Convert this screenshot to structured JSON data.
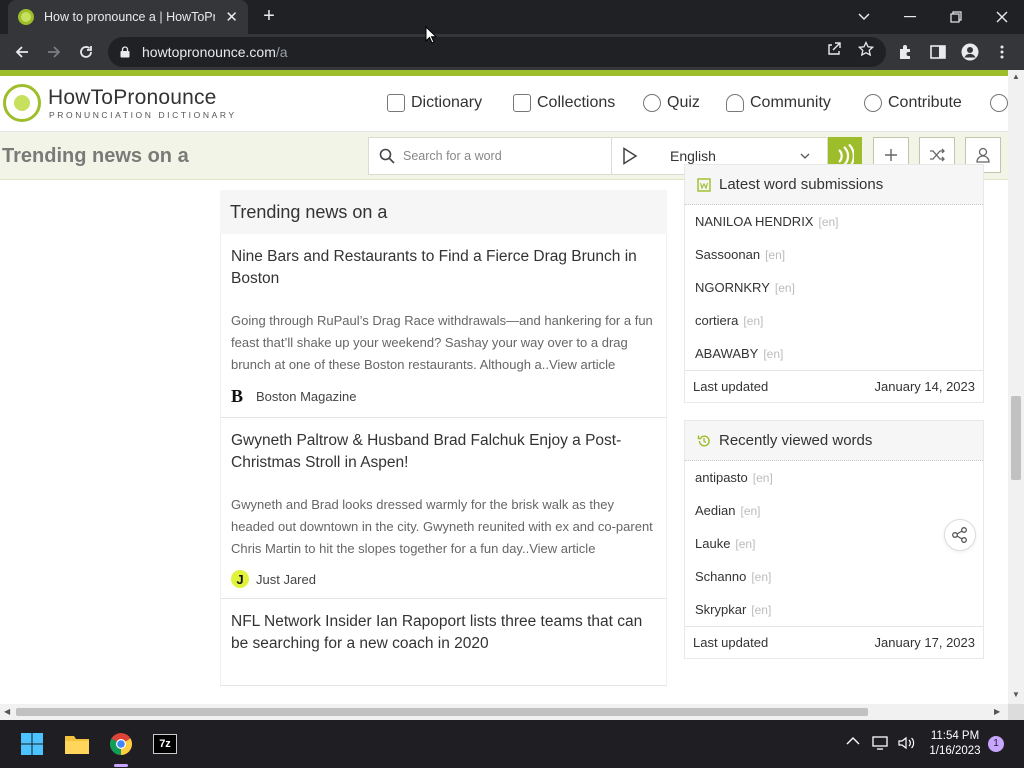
{
  "browser": {
    "tab_title": "How to pronounce a | HowToPronounce",
    "url_host": "howtopronounce.com",
    "url_path": "/a"
  },
  "site": {
    "logo_name": "HowToPronounce",
    "logo_sub": "PRONUNCIATION DICTIONARY",
    "nav": {
      "dictionary": "Dictionary",
      "collections": "Collections",
      "quiz": "Quiz",
      "community": "Community",
      "contribute": "Contribute"
    },
    "subbar_title": "Trending news on a",
    "search_placeholder": "Search for a word",
    "language": "English"
  },
  "news": {
    "heading": "Trending news on a",
    "articles": [
      {
        "title": "Nine Bars and Restaurants to Find a Fierce Drag Brunch in Boston",
        "body": "Going through RuPaul’s Drag Race withdrawals—and hankering for a fun feast that’ll shake up your weekend? Sashay your way over to a drag brunch at one of these Boston restaurants. Although a..View article",
        "source": "Boston Magazine",
        "source_logo": "B"
      },
      {
        "title": "Gwyneth Paltrow & Husband Brad Falchuk Enjoy a Post-Christmas Stroll in Aspen!",
        "body": "Gwyneth and Brad looks dressed warmly for the brisk walk as they headed out downtown in the city. Gwyneth reunited with ex and co-parent Chris Martin to hit the slopes together for a fun day..View article",
        "source": "Just Jared",
        "source_logo": "J"
      },
      {
        "title": "NFL Network Insider Ian Rapoport lists three teams that can be searching for a new coach in 2020"
      }
    ]
  },
  "latest": {
    "heading": "Latest word submissions",
    "words": [
      {
        "word": "NANILOA HENDRIX",
        "lang": "[en]"
      },
      {
        "word": "Sassoonan",
        "lang": "[en]"
      },
      {
        "word": "NGORNKRY",
        "lang": "[en]"
      },
      {
        "word": "cortiera",
        "lang": "[en]"
      },
      {
        "word": "ABAWABY",
        "lang": "[en]"
      }
    ],
    "footer_label": "Last updated",
    "footer_date": "January 14, 2023"
  },
  "recent": {
    "heading": "Recently viewed words",
    "words": [
      {
        "word": "antipasto",
        "lang": "[en]"
      },
      {
        "word": "Aedian",
        "lang": "[en]"
      },
      {
        "word": "Lauke",
        "lang": "[en]"
      },
      {
        "word": "Schanno",
        "lang": "[en]"
      },
      {
        "word": "Skrypkar",
        "lang": "[en]"
      }
    ],
    "footer_label": "Last updated",
    "footer_date": "January 17, 2023"
  },
  "taskbar": {
    "time": "11:54 PM",
    "date": "1/16/2023",
    "notifications": "1",
    "sevenzip_label": "7z"
  },
  "colors": {
    "brand_green": "#9ebd2a",
    "brand_light": "#c7e05d",
    "chrome_dark": "#202124"
  }
}
